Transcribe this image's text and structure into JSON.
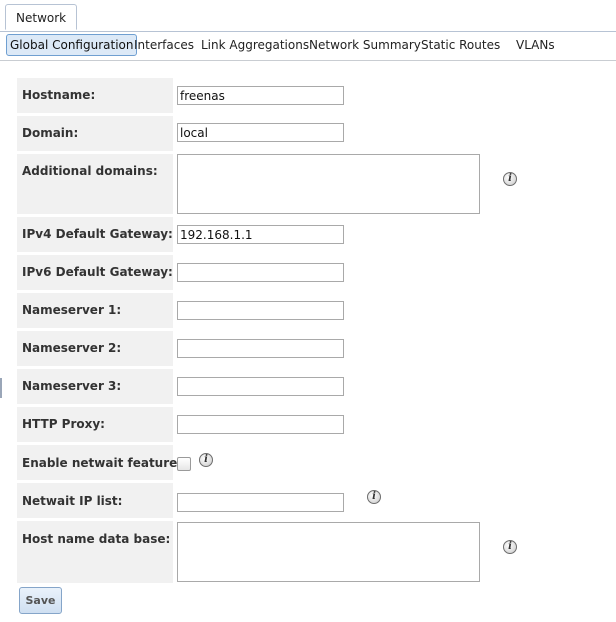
{
  "outer_tabs": [
    {
      "label": "Network",
      "active": true
    }
  ],
  "inner_tabs": [
    {
      "label": "Global Configuration",
      "active": true
    },
    {
      "label": "Interfaces",
      "active": false
    },
    {
      "label": "Link Aggregations",
      "active": false
    },
    {
      "label": "Network Summary",
      "active": false
    },
    {
      "label": "Static Routes",
      "active": false
    },
    {
      "label": "VLANs",
      "active": false
    }
  ],
  "form": {
    "hostname": {
      "label": "Hostname:",
      "value": "freenas"
    },
    "domain": {
      "label": "Domain:",
      "value": "local"
    },
    "additional_domains": {
      "label": "Additional domains:",
      "value": "",
      "help_icon": "info-icon"
    },
    "ipv4_gateway": {
      "label": "IPv4 Default Gateway:",
      "value": "192.168.1.1"
    },
    "ipv6_gateway": {
      "label": "IPv6 Default Gateway:",
      "value": ""
    },
    "nameserver1": {
      "label": "Nameserver 1:",
      "value": ""
    },
    "nameserver2": {
      "label": "Nameserver 2:",
      "value": ""
    },
    "nameserver3": {
      "label": "Nameserver 3:",
      "value": ""
    },
    "http_proxy": {
      "label": "HTTP Proxy:",
      "value": ""
    },
    "netwait_enabled": {
      "label": "Enable netwait feature:",
      "checked": false,
      "help_icon": "info-icon"
    },
    "netwait_ip_list": {
      "label": "Netwait IP list:",
      "value": "",
      "help_icon": "info-icon"
    },
    "host_name_db": {
      "label": "Host name data base:",
      "value": "",
      "help_icon": "info-icon"
    }
  },
  "actions": {
    "save_label": "Save"
  }
}
